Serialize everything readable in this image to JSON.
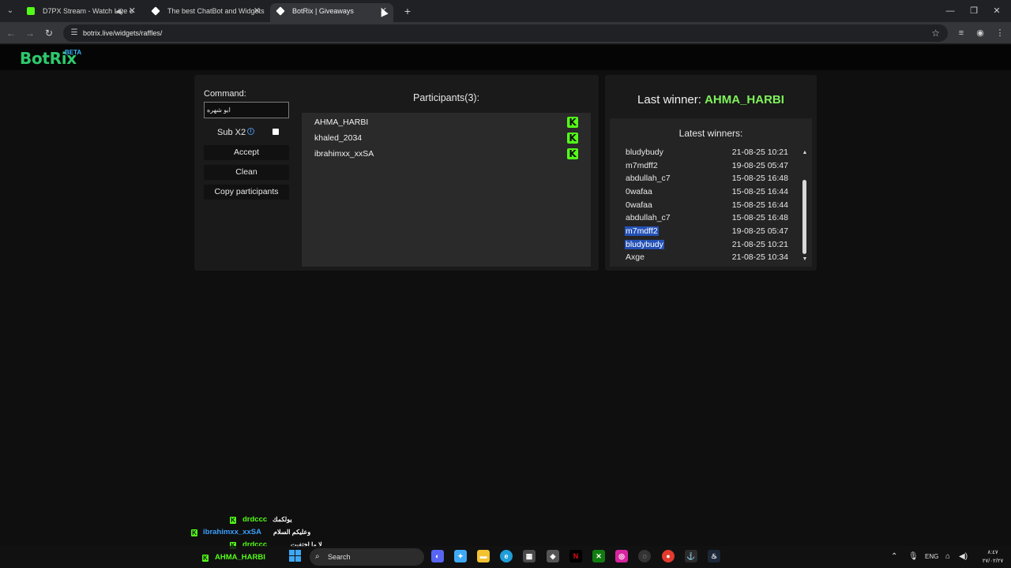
{
  "browser": {
    "tabs": [
      {
        "title": "D7PX Stream - Watch Live o",
        "favicon": "kick-icon",
        "active": false
      },
      {
        "title": "The best ChatBot and Widgets",
        "favicon": "botrix-icon",
        "active": false
      },
      {
        "title": "BotRix | Giveaways",
        "favicon": "botrix-icon",
        "active": true
      }
    ],
    "url": "botrix.live/widgets/raffles/"
  },
  "site": {
    "logo": "BotRix",
    "logo_badge": "BETA"
  },
  "controls": {
    "command_label": "Command:",
    "command_value": "ابو شهره",
    "sub_label": "Sub X2",
    "sub_checked": false,
    "accept_label": "Accept",
    "clean_label": "Clean",
    "copy_label": "Copy participants"
  },
  "participants": {
    "title": "Participants(3):",
    "items": [
      {
        "name": "AHMA_HARBI",
        "platform": "kick"
      },
      {
        "name": "khaled_2034",
        "platform": "kick"
      },
      {
        "name": "ibrahimxx_xxSA",
        "platform": "kick"
      }
    ]
  },
  "winners": {
    "last_winner_label": "Last winner:",
    "last_winner_name": "AHMA_HARBI",
    "latest_title": "Latest winners:",
    "items": [
      {
        "name": "bludybudy",
        "date": "21-08-25 10:21",
        "selected": false
      },
      {
        "name": "m7mdff2",
        "date": "19-08-25 05:47",
        "selected": false
      },
      {
        "name": "abdullah_c7",
        "date": "15-08-25 16:48",
        "selected": false
      },
      {
        "name": "0wafaa",
        "date": "15-08-25 16:44",
        "selected": false
      },
      {
        "name": "0wafaa",
        "date": "15-08-25 16:44",
        "selected": false
      },
      {
        "name": "abdullah_c7",
        "date": "15-08-25 16:48",
        "selected": false
      },
      {
        "name": "m7mdff2",
        "date": "19-08-25 05:47",
        "selected": true
      },
      {
        "name": "bludybudy",
        "date": "21-08-25 10:21",
        "selected": true
      },
      {
        "name": "Axge",
        "date": "21-08-25 10:34",
        "selected": false
      }
    ]
  },
  "chat_overlay": [
    {
      "user": "drdccc",
      "message": "يولكمك"
    },
    {
      "user": "ibrahimxx_xxSA",
      "message": "وعليكم السلام"
    },
    {
      "user": "drdccc",
      "message": "لا ما اختفيت"
    },
    {
      "user": "AHMA_HARBI",
      "message": ""
    }
  ],
  "taskbar": {
    "search_label": "Search",
    "language": "ENG",
    "time": "٨:٤٧",
    "date": "٢٧/٠٢/٢٧"
  },
  "colors": {
    "brand_green": "#2ec96c",
    "kick_green": "#53fc18",
    "winner_green": "#7ff25a",
    "selection_blue": "#2451b6"
  }
}
